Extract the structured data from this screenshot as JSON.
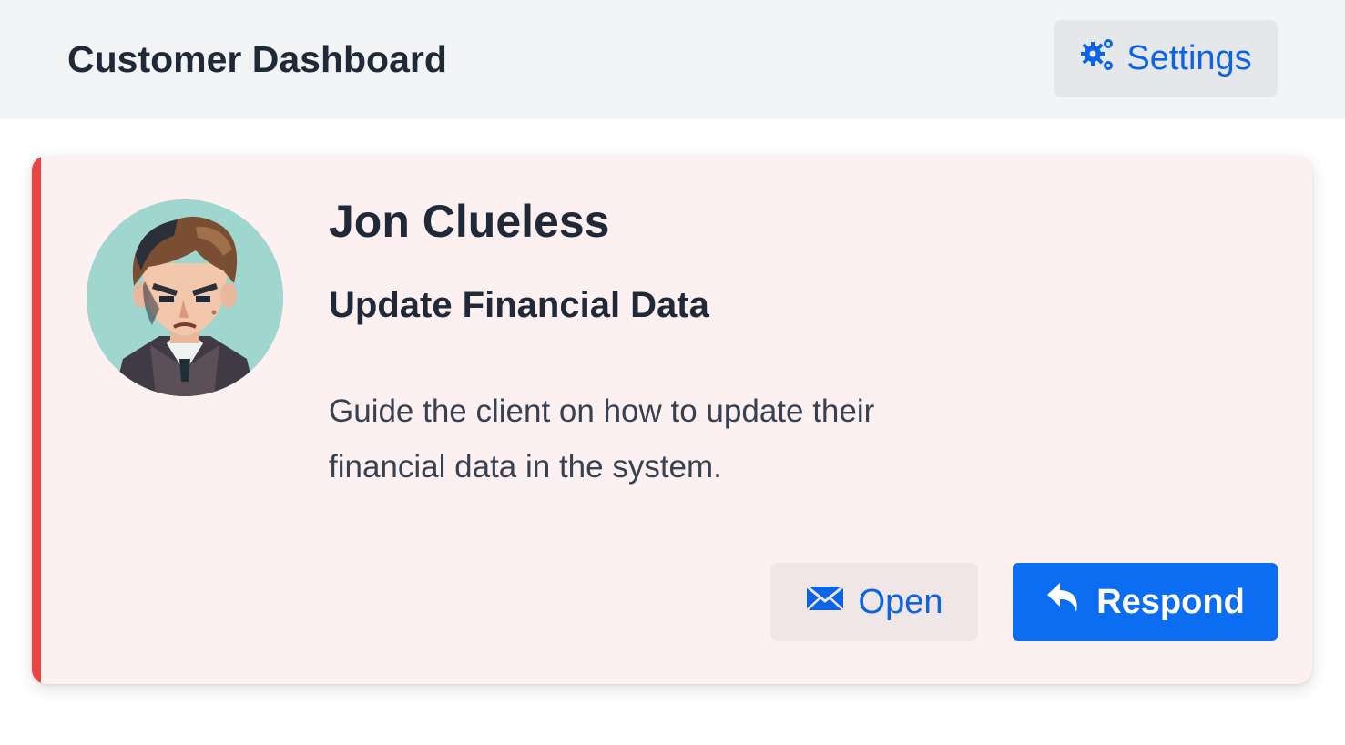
{
  "header": {
    "title": "Customer Dashboard",
    "settings_label": "Settings",
    "settings_icon": "gears-icon"
  },
  "ticket": {
    "customer_name": "Jon Clueless",
    "subject": "Update Financial Data",
    "description": "Guide the client on how to update their financial data in the system.",
    "avatar_icon": "avatar-illustration",
    "priority_color": "#ef4444"
  },
  "actions": {
    "open_label": "Open",
    "open_icon": "envelope-icon",
    "respond_label": "Respond",
    "respond_icon": "reply-arrow-icon"
  },
  "colors": {
    "accent": "#0b6ef2",
    "card_background": "#fdf0f0",
    "header_background": "#f3f4f6"
  }
}
